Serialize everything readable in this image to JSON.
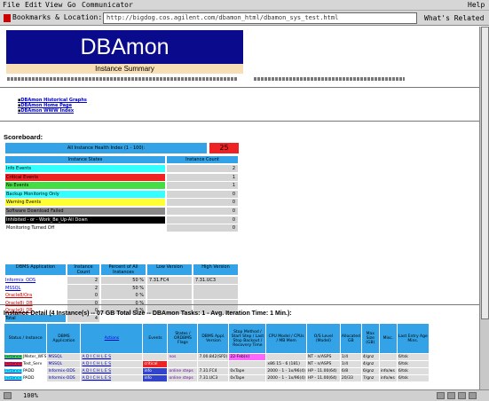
{
  "browser": {
    "menu": [
      "File",
      "Edit",
      "View",
      "Go",
      "Communicator"
    ],
    "help": "Help",
    "location_label": "Bookmarks & Location:",
    "url": "http://bigdog.cos.agilent.com/dbamon_html/dbamon_sys_test.html",
    "related": "What's Related",
    "zoom": "100%"
  },
  "page": {
    "title": "DBAmon",
    "subtitle": "Instance Summary",
    "nav_links": [
      "DBAmon Historical Graphs",
      "DBAmon Home Page",
      "DBAmon WWW Index"
    ]
  },
  "scoreboard": {
    "title": "Scoreboard:",
    "health_label": "All Instance Health Index (1 - 100):",
    "health_value": "25",
    "states_header": "Instance States",
    "count_header": "Instance Count",
    "states": [
      {
        "label": "Info Events",
        "count": "2",
        "color": "#33ffff"
      },
      {
        "label": "Critical Events",
        "count": "1",
        "color": "#ee2222"
      },
      {
        "label": "No Events",
        "count": "1",
        "color": "#44dd44"
      },
      {
        "label": "Backup Monitoring Only",
        "count": "0",
        "color": "#33ffff"
      },
      {
        "label": "Warning Events",
        "count": "0",
        "color": "#ffff33"
      },
      {
        "label": "Software Download Failed",
        "count": "0",
        "color": "#888888"
      },
      {
        "label": "Inhibited - or - Work_Be_Up-All Down",
        "count": "0",
        "color": "#000000"
      },
      {
        "label": "Monitoring Turned Off",
        "count": "0",
        "color": "#ffffff"
      }
    ],
    "dbms_headers": [
      "DBMS Application",
      "Instance Count",
      "Percent of All Instances",
      "Low Version",
      "High Version"
    ],
    "dbms_rows": [
      {
        "app": "Informix_ODS",
        "count": "2",
        "pct": "50 %",
        "low": "7.31.FC4",
        "high": "7.31.UC3"
      },
      {
        "app": "MSSQL",
        "count": "2",
        "pct": "50 %",
        "low": "",
        "high": ""
      },
      {
        "app": "Oracle8/Ora",
        "count": "0",
        "pct": "0 %",
        "low": "",
        "high": ""
      },
      {
        "app": "Oracle8i_DB",
        "count": "0",
        "pct": "0 %",
        "low": "",
        "high": ""
      },
      {
        "app": "Oracle9i_DB",
        "count": "0",
        "pct": "0 %",
        "low": "",
        "high": ""
      },
      {
        "app": "Total",
        "count": "4",
        "pct": "",
        "low": "",
        "high": ""
      }
    ]
  },
  "detail": {
    "title": "Instance Detail (4 Instance(s) -- 07 GB Total Size -- DBAmon Tasks: 1 - Avg. Iteration Time: 1 Min.):",
    "headers": [
      "Status / Instance",
      "DBMS Application",
      "Actions",
      "Events",
      "States / ORDBMS Flags",
      "DBMS Appl. Version",
      "Stop Method / Start Step / Last Stop Backout / Recovery Time",
      "CPU Model / CPUs / MB Mem",
      "O/S Level (Model)",
      "Allocated GB",
      "Max Size (GB)",
      "Misc.",
      "Last Entry Age Mins."
    ],
    "actions": "A D I C H L E S",
    "rows": [
      {
        "status_color": "#44dd44",
        "status": "Instance",
        "instance": "JMeter_WFS",
        "app": "MSSQL",
        "events": "",
        "states": "nos",
        "ver": "7.00.842(SP2)",
        "stop": "22-Feb(n)",
        "stop_color": "#ff66ff",
        "cpu": "",
        "os": "NT - n/ASPS",
        "alloc": "1/4",
        "max": "4/gnz",
        "misc": "",
        "age": "6/tsk"
      },
      {
        "status_color": "#ee2222",
        "status": "Instance",
        "instance": "Test_Serv",
        "app": "MSSQL",
        "events": "critical",
        "states": "",
        "ver": "",
        "stop": "",
        "stop_color": "",
        "cpu": "x86 15 - 6 (181)",
        "os": "NT - n/ASPS",
        "alloc": "1/4",
        "max": "4/gnz",
        "misc": "",
        "age": "6/tsk"
      },
      {
        "status_color": "#33ffff",
        "status": "Instance",
        "instance": "PADD",
        "app": "Informix-ODS",
        "events": "info",
        "states": "online steps",
        "ver": "7.31.FC4",
        "stop": "0xTape",
        "stop_color": "",
        "cpu": "2000 - 1 - 1x/96(4)",
        "os": "HP - 11.00(64)",
        "alloc": "6/8",
        "max": "6/gnz",
        "misc": "info/ws",
        "age": "6/tsk"
      },
      {
        "status_color": "#33ffff",
        "status": "Instance",
        "instance": "PADD",
        "app": "Informix-ODS",
        "events": "info",
        "states": "online steps",
        "ver": "7.31.UC3",
        "stop": "0xTape",
        "stop_color": "",
        "cpu": "2000 - 1 - 1x/96(4)",
        "os": "HP - 11.00(64)",
        "alloc": "20/33",
        "max": "7/gnz",
        "misc": "info/ws",
        "age": "6/tsk"
      }
    ]
  }
}
